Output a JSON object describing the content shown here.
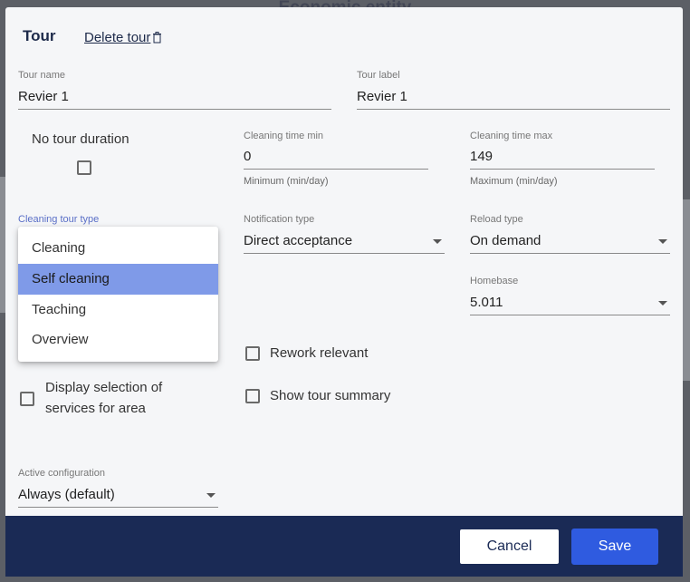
{
  "backdrop": {
    "title": "Economic entity"
  },
  "dialog": {
    "title": "Tour",
    "delete_label": "Delete tour"
  },
  "fields": {
    "tour_name": {
      "label": "Tour name",
      "value": "Revier 1"
    },
    "tour_label": {
      "label": "Tour label",
      "value": "Revier 1"
    },
    "no_tour_duration": {
      "label": "No tour duration",
      "checked": false
    },
    "cleaning_time_min": {
      "label": "Cleaning time min",
      "value": "0",
      "help": "Minimum (min/day)"
    },
    "cleaning_time_max": {
      "label": "Cleaning time max",
      "value": "149",
      "help": "Maximum (min/day)"
    },
    "cleaning_tour_type": {
      "label": "Cleaning tour type"
    },
    "notification_type": {
      "label": "Notification type",
      "value": "Direct acceptance"
    },
    "reload_type": {
      "label": "Reload type",
      "value": "On demand"
    },
    "homebase": {
      "label": "Homebase",
      "value": "5.011"
    },
    "rework_relevant": {
      "label": "Rework relevant",
      "checked": false
    },
    "display_selection": {
      "label_line1": "Display selection of",
      "label_line2": "services for area",
      "checked": false
    },
    "show_tour_summary": {
      "label": "Show tour summary",
      "checked": false
    },
    "active_configuration": {
      "label": "Active configuration",
      "value": "Always (default)"
    }
  },
  "dropdown": {
    "options": [
      "Cleaning",
      "Self cleaning",
      "Teaching",
      "Overview"
    ],
    "highlighted": "Self cleaning"
  },
  "footer": {
    "cancel_label": "Cancel",
    "save_label": "Save"
  },
  "colors": {
    "primary": "#2f5be0",
    "footer": "#1a2a55",
    "highlight": "#7f9ae8",
    "active_label": "#5a6fc7"
  }
}
